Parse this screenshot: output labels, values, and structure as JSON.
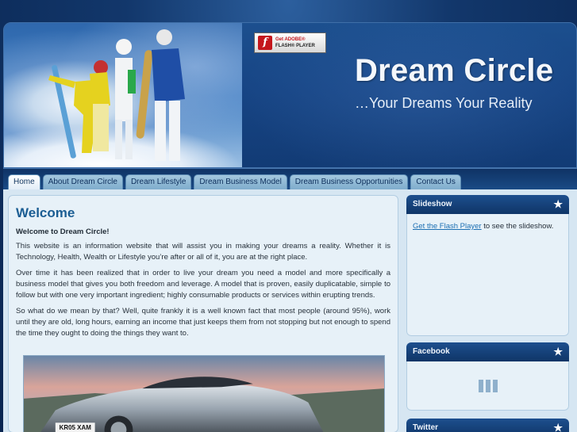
{
  "header": {
    "site_title": "Dream Circle",
    "tagline": "…Your Dreams Your Reality",
    "flash_badge": {
      "line1": "Get ADOBE®",
      "line2": "FLASH® PLAYER",
      "logo": "f"
    }
  },
  "nav": {
    "tabs": [
      {
        "label": "Home",
        "active": true
      },
      {
        "label": "About Dream Circle"
      },
      {
        "label": "Dream Lifestyle"
      },
      {
        "label": "Dream Business Model"
      },
      {
        "label": "Dream Business Opportunities"
      },
      {
        "label": "Contact Us"
      }
    ]
  },
  "main": {
    "title": "Welcome",
    "intro": "Welcome to Dream Circle!",
    "paragraphs": [
      "This website is an information website that will assist you in making your dreams a reality. Whether it is Technology, Health, Wealth or Lifestyle you’re after or all of it, you are at the right place.",
      "Over time it has been realized that in order to live your dream you need a model and more specifically a business model that gives you both freedom and leverage. A model that is proven, easily duplicatable, simple to follow but with one very important ingredient; highly consumable products or services within erupting trends.",
      "So what do we mean by that? Well, quite frankly it is a well known fact that most people (around 95%), work until they are old, long hours, earning an income that just keeps them from not stopping but not enough to spend the time they ought to doing the things they want to."
    ],
    "car_plate": "KR05 XAM"
  },
  "sidebar": {
    "slideshow": {
      "title": "Slideshow",
      "link": "Get the Flash Player",
      "text": " to see the slideshow."
    },
    "facebook": {
      "title": "Facebook"
    },
    "twitter": {
      "title": "Twitter"
    }
  },
  "icons": {
    "widget_star": "star-icon",
    "loading": "loading-bars-icon"
  },
  "colors": {
    "header_bg": "#174585",
    "title_blue": "#1b5d93",
    "content_bg": "#e7f1f8"
  }
}
